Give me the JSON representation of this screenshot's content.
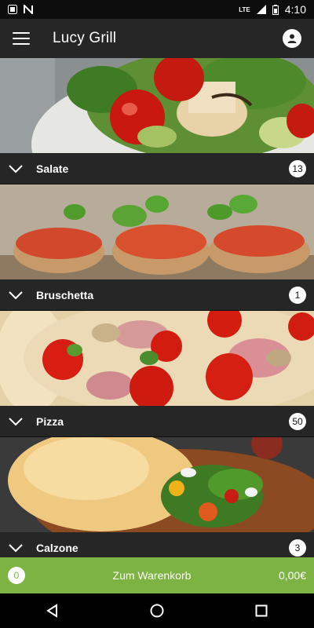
{
  "status_bar": {
    "time": "4:10",
    "network": "LTE"
  },
  "app_bar": {
    "title": "Lucy Grill",
    "menu_icon": "menu-icon",
    "account_icon": "account-icon"
  },
  "categories": [
    {
      "name": "Salate",
      "count": "13"
    },
    {
      "name": "Bruschetta",
      "count": "1"
    },
    {
      "name": "Pizza",
      "count": "50"
    },
    {
      "name": "Calzone",
      "count": "3"
    }
  ],
  "cart": {
    "count": "0",
    "label": "Zum Warenkorb",
    "total": "0,00€",
    "color": "#7cb342"
  },
  "nav": {
    "back_icon": "back-icon",
    "home_icon": "home-icon",
    "recents_icon": "recents-icon"
  }
}
